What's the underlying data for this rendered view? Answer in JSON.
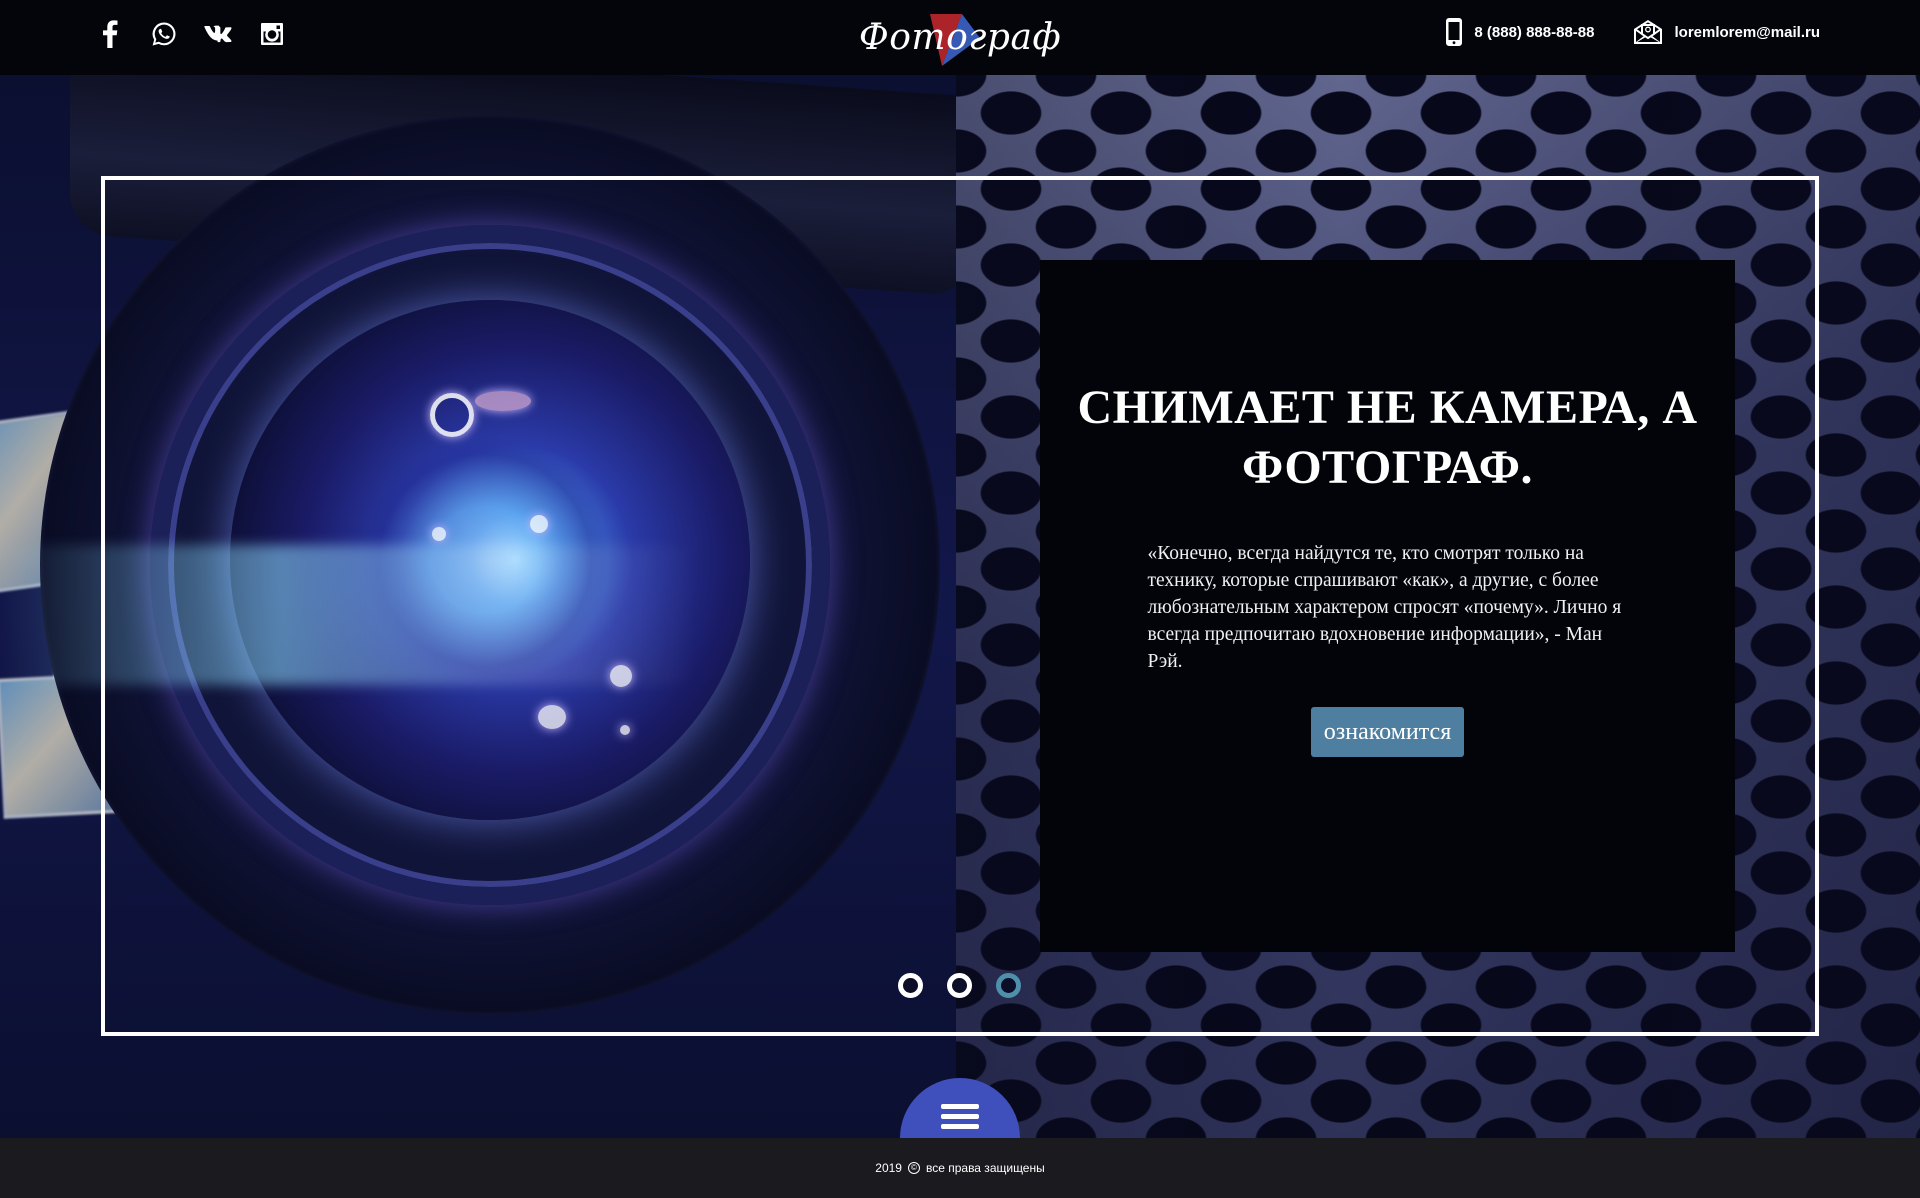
{
  "header": {
    "social": [
      {
        "name": "facebook",
        "icon": "facebook-icon"
      },
      {
        "name": "whatsapp",
        "icon": "whatsapp-icon"
      },
      {
        "name": "vk",
        "icon": "vk-icon"
      },
      {
        "name": "instagram",
        "icon": "instagram-icon"
      }
    ],
    "logo_text": "Фотограф",
    "phone": "8 (888) 888-88-88",
    "email": "loremlorem@mail.ru"
  },
  "hero": {
    "title": "СНИМАЕТ НЕ КАМЕРА, А ФОТОГРАФ.",
    "quote": "«Конечно, всегда найдутся те, кто смотрят только на технику, которые спрашивают «как», а другие, с более любознательным характером спросят «почему». Лично я всегда предпочитаю вдохновение информации», - Ман Рэй.",
    "button_label": "ознакомится",
    "slides_count": 3,
    "active_slide": 3
  },
  "footer": {
    "year": "2019",
    "rights": "все права защищены"
  },
  "colors": {
    "accent": "#4e7ea0",
    "menu_button": "#3f4fbc",
    "active_dot": "#4e8fab",
    "header_bg": "#04050a",
    "footer_bg": "#1b1b1f"
  }
}
